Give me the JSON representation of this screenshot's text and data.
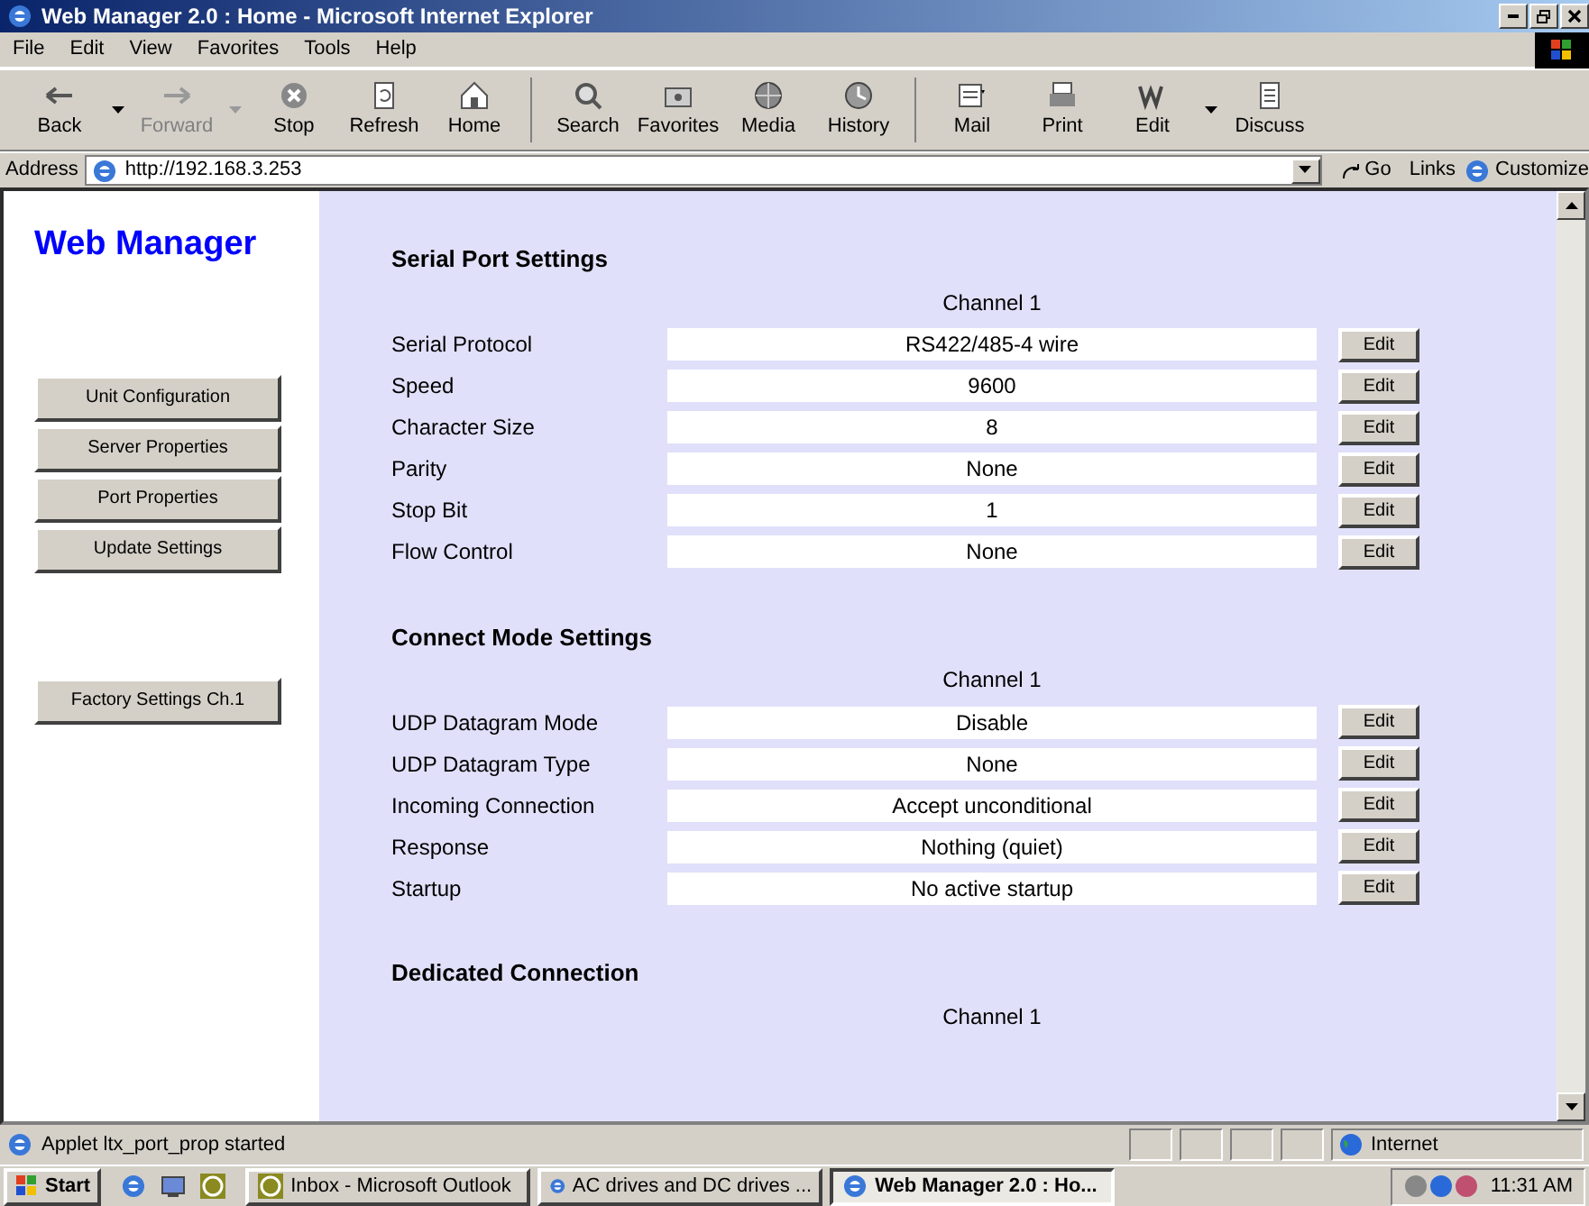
{
  "window": {
    "title": "Web Manager 2.0 : Home - Microsoft Internet Explorer"
  },
  "menu": [
    "File",
    "Edit",
    "View",
    "Favorites",
    "Tools",
    "Help"
  ],
  "toolbar": [
    {
      "label": "Back",
      "disabled": false,
      "dropdown": true
    },
    {
      "label": "Forward",
      "disabled": true,
      "dropdown": true
    },
    {
      "label": "Stop",
      "disabled": false,
      "dropdown": false
    },
    {
      "label": "Refresh",
      "disabled": false,
      "dropdown": false
    },
    {
      "label": "Home",
      "disabled": false,
      "dropdown": false
    },
    {
      "label": "Search",
      "disabled": false,
      "dropdown": false
    },
    {
      "label": "Favorites",
      "disabled": false,
      "dropdown": false
    },
    {
      "label": "Media",
      "disabled": false,
      "dropdown": false
    },
    {
      "label": "History",
      "disabled": false,
      "dropdown": false
    },
    {
      "label": "Mail",
      "disabled": false,
      "dropdown": false
    },
    {
      "label": "Print",
      "disabled": false,
      "dropdown": false
    },
    {
      "label": "Edit",
      "disabled": false,
      "dropdown": true
    },
    {
      "label": "Discuss",
      "disabled": false,
      "dropdown": false
    }
  ],
  "address_bar": {
    "label": "Address",
    "url": "http://192.168.3.253",
    "go": "Go",
    "links": "Links",
    "customize": "Customize"
  },
  "page": {
    "brand": "Web Manager",
    "nav": [
      "Unit Configuration",
      "Server Properties",
      "Port Properties",
      "Update Settings"
    ],
    "factory_button": "Factory Settings Ch.1",
    "sections": [
      {
        "title": "Serial Port Settings",
        "channel": "Channel 1",
        "rows": [
          {
            "label": "Serial Protocol",
            "value": "RS422/485-4 wire",
            "button": "Edit"
          },
          {
            "label": "Speed",
            "value": "9600",
            "button": "Edit"
          },
          {
            "label": "Character Size",
            "value": "8",
            "button": "Edit"
          },
          {
            "label": "Parity",
            "value": "None",
            "button": "Edit"
          },
          {
            "label": "Stop Bit",
            "value": "1",
            "button": "Edit"
          },
          {
            "label": "Flow Control",
            "value": "None",
            "button": "Edit"
          }
        ]
      },
      {
        "title": "Connect Mode Settings",
        "channel": "Channel 1",
        "rows": [
          {
            "label": "UDP Datagram Mode",
            "value": "Disable",
            "button": "Edit"
          },
          {
            "label": "UDP Datagram Type",
            "value": "None",
            "button": "Edit"
          },
          {
            "label": "Incoming Connection",
            "value": "Accept unconditional",
            "button": "Edit"
          },
          {
            "label": "Response",
            "value": "Nothing (quiet)",
            "button": "Edit"
          },
          {
            "label": "Startup",
            "value": "No active startup",
            "button": "Edit"
          }
        ]
      },
      {
        "title": "Dedicated Connection",
        "channel": "Channel 1"
      }
    ]
  },
  "status_bar": {
    "message": "Applet ltx_port_prop started",
    "zone": "Internet"
  },
  "taskbar": {
    "start": "Start",
    "tasks": [
      {
        "label": "Inbox - Microsoft Outlook",
        "selected": false
      },
      {
        "label": "AC drives and DC drives ...",
        "selected": false
      },
      {
        "label": "Web Manager 2.0 : Ho...",
        "selected": true
      }
    ],
    "clock": "11:31 AM"
  }
}
